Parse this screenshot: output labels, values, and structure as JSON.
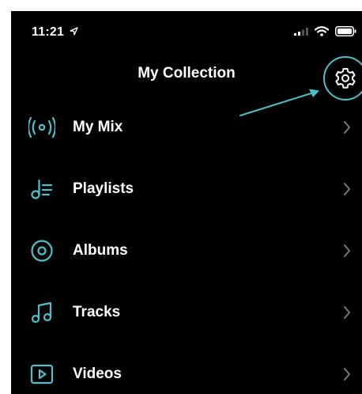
{
  "status_bar": {
    "time": "11:21"
  },
  "header": {
    "title": "My Collection"
  },
  "menu": {
    "items": [
      {
        "label": "My Mix",
        "icon": "broadcast-icon"
      },
      {
        "label": "Playlists",
        "icon": "playlist-icon"
      },
      {
        "label": "Albums",
        "icon": "album-disc-icon"
      },
      {
        "label": "Tracks",
        "icon": "music-note-icon"
      },
      {
        "label": "Videos",
        "icon": "video-play-icon"
      }
    ]
  },
  "colors": {
    "accent": "#4ec0cc",
    "background": "#000000",
    "text": "#ffffff",
    "chevron": "#7a7a7a"
  }
}
